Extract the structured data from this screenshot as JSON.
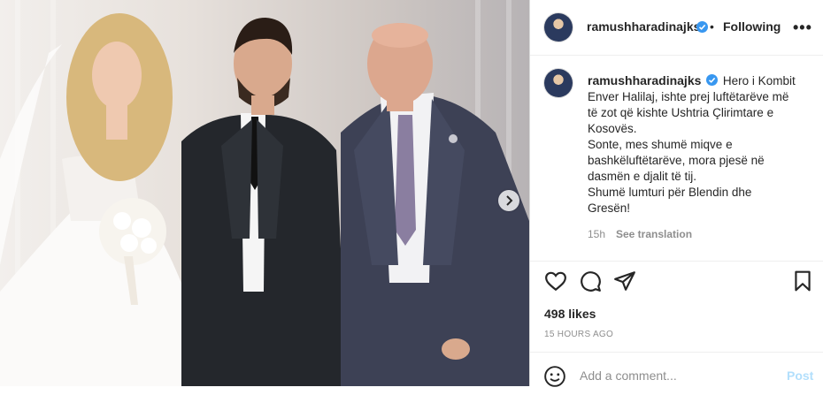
{
  "post": {
    "username": "ramushharadinajks",
    "follow_separator": "•",
    "follow_label": "Following",
    "more_label": "•••",
    "caption_lines": [
      "Hero i Kombit",
      "Enver Halilaj, ishte prej luftëtarëve më",
      "të zot që kishte Ushtria Çlirimtare e",
      "Kosovës.",
      "Sonte, mes shumë miqve e",
      "bashkëluftëtarëve, mora pjesë në",
      "dasmën e djalit të tij.",
      "Shumë lumturi për Blendin dhe",
      "Gresën!"
    ],
    "time": "15h",
    "see_translation": "See translation",
    "likes": "498 likes",
    "posted_ago": "15 HOURS AGO",
    "comment_placeholder": "Add a comment...",
    "post_button": "Post"
  },
  "carousel": {
    "slide_count": 3,
    "active_index": 0
  },
  "icons": {
    "verified": "verified-badge-icon",
    "like": "heart-icon",
    "comment": "comment-bubble-icon",
    "share": "paper-plane-icon",
    "save": "bookmark-icon",
    "emoji": "smiley-icon",
    "next": "chevron-right-icon"
  },
  "colors": {
    "verified": "#3897f0",
    "post_button": "#b2dffc",
    "muted": "#8e8e8e"
  }
}
